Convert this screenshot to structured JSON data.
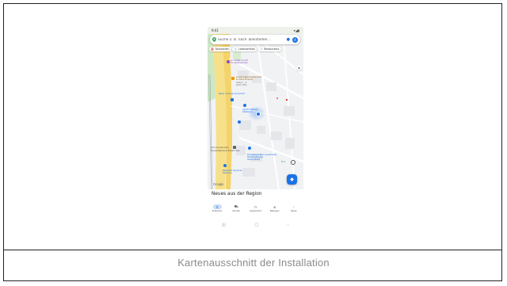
{
  "caption": "Kartenausschnitt der Installation",
  "phone": {
    "status_bar": {
      "time": "9:41",
      "icons": "▾◢▮"
    },
    "search": {
      "placeholder": "Suche z. B. nach Tankstellen...",
      "avatar_letter": "A"
    },
    "chips": [
      {
        "icon": "⛽",
        "label": "Tankstellen"
      },
      {
        "icon": "🛒",
        "label": "Lebensmittel"
      },
      {
        "icon": "🍴",
        "label": "Restaurants"
      }
    ],
    "map_labels": [
      {
        "text": "Domizile im Klif\nfür Maßnahmen",
        "color": "#8a4bd0"
      },
      {
        "text": "La Famiglia Restaurant\n& Pizza Bussha",
        "color": "#a36a1b"
      },
      {
        "text": "Italian · $\nJetzt offen",
        "color": "#777777"
      },
      {
        "text": "Bank Colonia Lindenhof",
        "color": "#1a73e8"
      },
      {
        "text": "Spieth Patient\nStationen",
        "color": "#1a73e8"
      },
      {
        "text": "Lidl Aachenerstr.",
        "color": "#555555"
      },
      {
        "text": "Hausarztpraxis Euskirchen",
        "color": "#555555"
      },
      {
        "text": "Dienstag & Bus Lenamade\nParkbe Raedig\nGesundheit",
        "color": "#1a73e8"
      },
      {
        "text": "Pfarramt Sprinkel\nKantone",
        "color": "#1a73e8"
      }
    ],
    "go_text": "Eco",
    "google_logo": "Google",
    "sheet_title": "Neues aus der Region",
    "bottom_nav": [
      {
        "icon": "⚲",
        "label": "Entdecken",
        "active": true
      },
      {
        "icon": "⛟",
        "label": "Pendeln",
        "active": false
      },
      {
        "icon": "⊓",
        "label": "Gespeichert",
        "active": false
      },
      {
        "icon": "⊕",
        "label": "Beitragen",
        "active": false
      },
      {
        "icon": "♢",
        "label": "Neues",
        "active": false
      }
    ],
    "system_nav": [
      "|||",
      "◯",
      "‹"
    ],
    "colors": {
      "accent": "#1a73e8",
      "road_yellow": "#f7e08a",
      "park_green": "#cde8c5"
    }
  }
}
